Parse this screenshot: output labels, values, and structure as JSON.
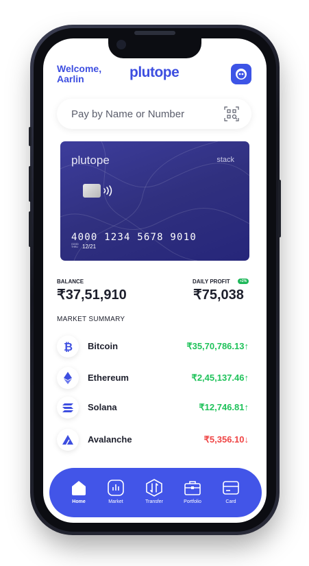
{
  "header": {
    "welcome_line1": "Welcome,",
    "welcome_line2": "Aarlin",
    "brand": "plutope"
  },
  "search": {
    "placeholder": "Pay by Name or Number"
  },
  "card": {
    "brand": "plutope",
    "tag": "stack",
    "number": "4000 1234 5678 9010",
    "good_thru_1": "GOOD",
    "good_thru_2": "THRU",
    "expiry": "12/21"
  },
  "balance": {
    "label": "BALANCE",
    "value": "₹37,51,910"
  },
  "profit": {
    "label": "DAILY PROFIT",
    "badge": "+2%",
    "value": "₹75,038"
  },
  "market": {
    "title": "MARKET SUMMARY",
    "coins": [
      {
        "name": "Bitcoin",
        "price": "₹35,70,786.13↑",
        "trend": "up",
        "icon": "bitcoin-icon",
        "color": "#3d4ee0"
      },
      {
        "name": "Ethereum",
        "price": "₹2,45,137.46↑",
        "trend": "up",
        "icon": "ethereum-icon",
        "color": "#3d4ee0"
      },
      {
        "name": "Solana",
        "price": "₹12,746.81↑",
        "trend": "up",
        "icon": "solana-icon",
        "color": "#3d4ee0"
      },
      {
        "name": "Avalanche",
        "price": "₹5,356.10↓",
        "trend": "down",
        "icon": "avalanche-icon",
        "color": "#3d4ee0"
      }
    ]
  },
  "nav": {
    "items": [
      {
        "label": "Home",
        "icon": "home-icon",
        "active": true
      },
      {
        "label": "Market",
        "icon": "chart-icon"
      },
      {
        "label": "Transfer",
        "icon": "transfer-icon"
      },
      {
        "label": "Portfolio",
        "icon": "briefcase-icon"
      },
      {
        "label": "Card",
        "icon": "card-icon"
      }
    ]
  },
  "colors": {
    "accent": "#3d4ee0",
    "nav_bg": "#4255e8",
    "up": "#1fc25a",
    "down": "#ef4444",
    "card": "#30307f"
  }
}
